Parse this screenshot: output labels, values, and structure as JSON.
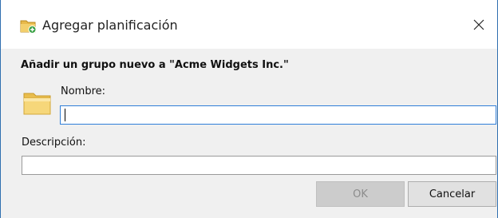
{
  "dialog": {
    "title": "Agregar planificación",
    "heading": "Añadir un grupo nuevo a \"Acme Widgets Inc.\"",
    "name_label": "Nombre:",
    "name_value": "",
    "description_label": "Descripción:",
    "description_value": "",
    "ok_label": "OK",
    "ok_enabled": false,
    "cancel_label": "Cancelar"
  },
  "icons": {
    "title_icon": "folder-add-icon",
    "group_icon": "folder-icon",
    "close_icon": "close-icon"
  },
  "colors": {
    "focus_border": "#2f7ed8",
    "window_border": "#2f6fb0",
    "dialog_background": "#f0f0f0"
  }
}
